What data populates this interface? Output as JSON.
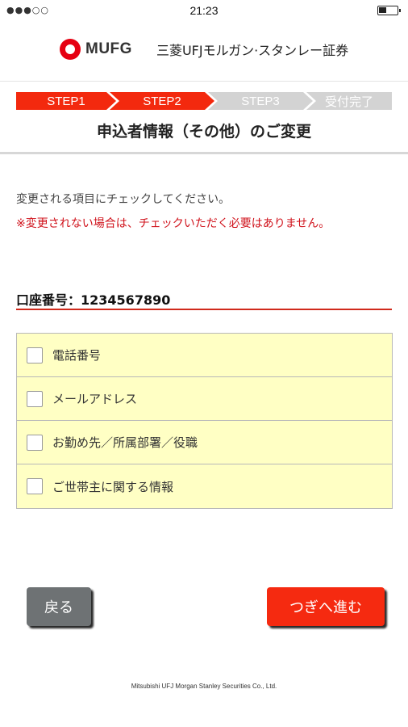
{
  "status_bar": {
    "signal": "●●●○○",
    "time": "21:23"
  },
  "brand": {
    "logo_text": "MUFG",
    "company_name": "三菱UFJモルガン·スタンレー証券"
  },
  "steps": [
    {
      "label": "STEP1",
      "state": "done"
    },
    {
      "label": "STEP2",
      "state": "active"
    },
    {
      "label": "STEP3",
      "state": "todo"
    },
    {
      "label": "受付完了",
      "state": "todo"
    }
  ],
  "page_title": "申込者情報（その他）のご変更",
  "instruction": "変更される項目にチェックしてください。",
  "warning": "※変更されない場合は、チェックいただく必要はありません。",
  "account": {
    "label": "口座番号：",
    "number": "1234567890"
  },
  "options": [
    {
      "label": "電話番号",
      "checked": false
    },
    {
      "label": "メールアドレス",
      "checked": false
    },
    {
      "label": "お勤め先／所属部署／役職",
      "checked": false
    },
    {
      "label": "ご世帯主に関する情報",
      "checked": false
    }
  ],
  "buttons": {
    "back": "戻る",
    "next": "つぎへ進む"
  },
  "footer": "Mitsubishi UFJ Morgan Stanley Securities Co., Ltd.",
  "colors": {
    "accent_red": "#f3290e",
    "step_inactive": "#d3d3d3",
    "option_bg": "#ffffc4",
    "back_button": "#6e7274",
    "warning_text": "#d0121b"
  }
}
